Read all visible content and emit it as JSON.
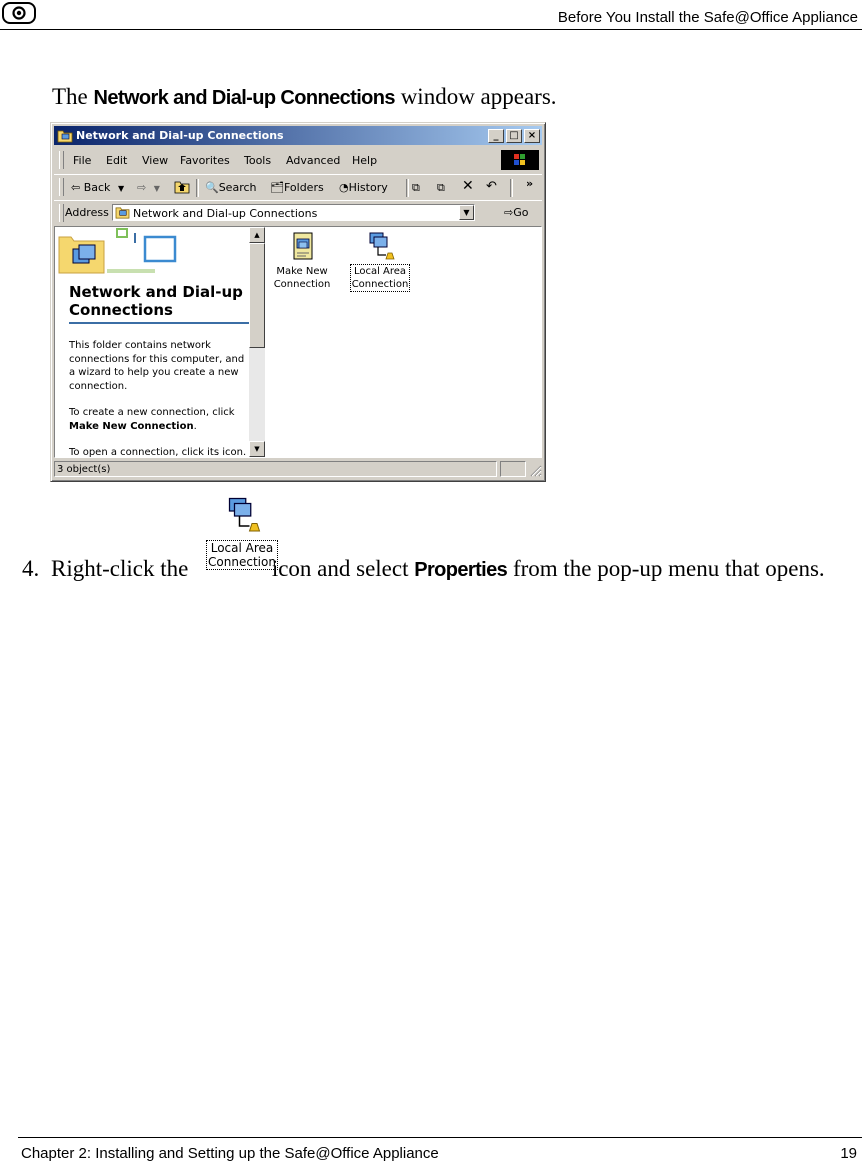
{
  "header": {
    "title": "Before You Install the Safe@Office Appliance",
    "logo_icon": "check-point-logo-icon"
  },
  "intro": {
    "prefix": "The",
    "bold": "Network and Dial-up Connections",
    "suffix": "window appears."
  },
  "window": {
    "title": "Network and Dial-up Connections",
    "caption_buttons": [
      "_",
      "□",
      "×"
    ],
    "menu": [
      "File",
      "Edit",
      "View",
      "Favorites",
      "Tools",
      "Advanced",
      "Help"
    ],
    "toolbar": {
      "back": "Back",
      "search": "Search",
      "folders": "Folders",
      "history": "History",
      "more": "»"
    },
    "address": {
      "label": "Address",
      "value": "Network and Dial-up Connections",
      "go": "Go"
    },
    "left_pane": {
      "title": "Network and Dial-up Connections",
      "p1": "This folder contains network connections for this computer, and a wizard to help you create a new connection.",
      "p2_prefix": "To create a new connection, click",
      "p2_bold": "Make New Connection",
      "p2_suffix": ".",
      "p3": "To open a connection, click its icon."
    },
    "icons": [
      {
        "label_line1": "Make New",
        "label_line2": "Connection",
        "icon": "make-new-connection-icon"
      },
      {
        "label_line1": "Local Area",
        "label_line2": "Connection",
        "icon": "local-area-connection-icon"
      }
    ],
    "status": "3 object(s)"
  },
  "step": {
    "number": "4.",
    "text_before": "Right-click the",
    "text_middle": "icon and select",
    "bold": "Properties",
    "text_after": "from the pop-up menu that opens.",
    "icon_label_line1": "Local Area",
    "icon_label_line2": "Connection"
  },
  "footer": {
    "chapter": "Chapter 2: Installing and Setting up the Safe@Office Appliance",
    "page": "19"
  },
  "colors": {
    "titlebar_start": "#0a246a",
    "titlebar_end": "#a6caf0",
    "window_face": "#d4d0c8"
  }
}
